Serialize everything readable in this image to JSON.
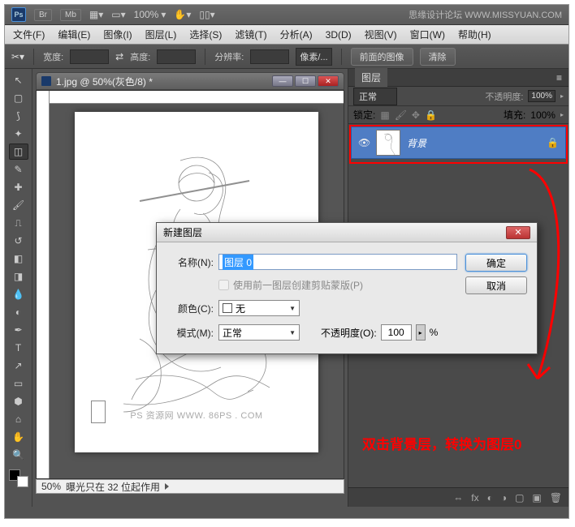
{
  "header": {
    "ps_label": "Ps",
    "br_btn": "Br",
    "mb_btn": "Mb",
    "zoom_pct": "100%",
    "right_text": "思缘设计论坛 WWW.MISSYUAN.COM"
  },
  "menu": {
    "file": "文件(F)",
    "edit": "编辑(E)",
    "image": "图像(I)",
    "layer": "图层(L)",
    "select": "选择(S)",
    "filter": "滤镜(T)",
    "analysis": "分析(A)",
    "threeD": "3D(D)",
    "view": "视图(V)",
    "window": "窗口(W)",
    "help": "帮助(H)"
  },
  "optbar": {
    "width_label": "宽度:",
    "height_label": "高度:",
    "res_label": "分辨率:",
    "unit_select": "像素/...",
    "front_btn": "前面的图像",
    "clear_btn": "清除"
  },
  "doc": {
    "title": "1.jpg @ 50%(灰色/8) *",
    "watermark": "PS 资源网  WWW. 86PS . COM",
    "status_zoom": "50%",
    "status_text": "曝光只在 32 位起作用"
  },
  "panel": {
    "tab": "图层",
    "blend_mode": "正常",
    "opacity_label": "不透明度:",
    "opacity_val": "100%",
    "lock_label": "锁定:",
    "fill_label": "填充:",
    "fill_val": "100%",
    "layer_name": "背景"
  },
  "dialog": {
    "title": "新建图层",
    "name_label": "名称(N):",
    "name_value": "图层 0",
    "clip_checkbox": "使用前一图层创建剪贴蒙版(P)",
    "color_label": "颜色(C):",
    "color_value": "无",
    "mode_label": "模式(M):",
    "mode_value": "正常",
    "opacity_label": "不透明度(O):",
    "opacity_value": "100",
    "opacity_unit": "%",
    "ok_btn": "确定",
    "cancel_btn": "取消"
  },
  "annotation": "双击背景层，转换为图层0"
}
